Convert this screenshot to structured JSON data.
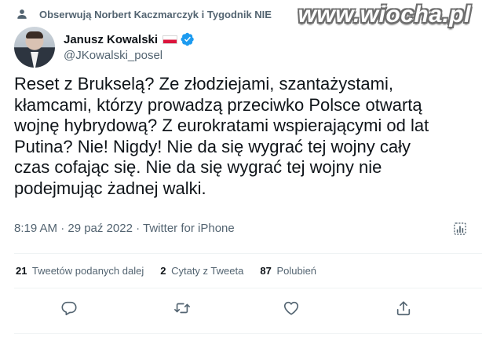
{
  "social_context": {
    "text": "Obserwują Norbert Kaczmarczyk i Tygodnik NIE"
  },
  "watermark": {
    "text": "www.wiocha.pl"
  },
  "author": {
    "name": "Janusz Kowalski",
    "handle": "@JKowalski_posel"
  },
  "tweet": {
    "text": "Reset z Brukselą? Ze złodziejami, szantażystami,\nkłamcami, którzy prowadzą przeciwko Polsce otwartą\nwojnę hybrydową? Z eurokratami wspierającymi od lat\nPutina? Nie! Nigdy! Nie da się wygrać tej wojny cały\nczas cofając się. Nie da się wygrać tej wojny nie\npodejmując żadnej walki.",
    "meta": "8:19 AM · 29 paź 2022 · Twitter for iPhone"
  },
  "stats": [
    {
      "count": "21",
      "label": "Tweetów podanych dalej"
    },
    {
      "count": "2",
      "label": "Cytaty z Tweeta"
    },
    {
      "count": "87",
      "label": "Polubień"
    }
  ],
  "icons": {
    "social_context": "person-follow-icon",
    "verified": "verified-badge-icon",
    "flag": "poland-flag-icon",
    "analytics": "analytics-icon",
    "reply": "reply-icon",
    "retweet": "retweet-icon",
    "like": "like-icon",
    "share": "share-icon"
  },
  "colors": {
    "text": "#0f1419",
    "secondary": "#536471",
    "verified": "#1d9bf0",
    "divider": "#eff3f4"
  }
}
